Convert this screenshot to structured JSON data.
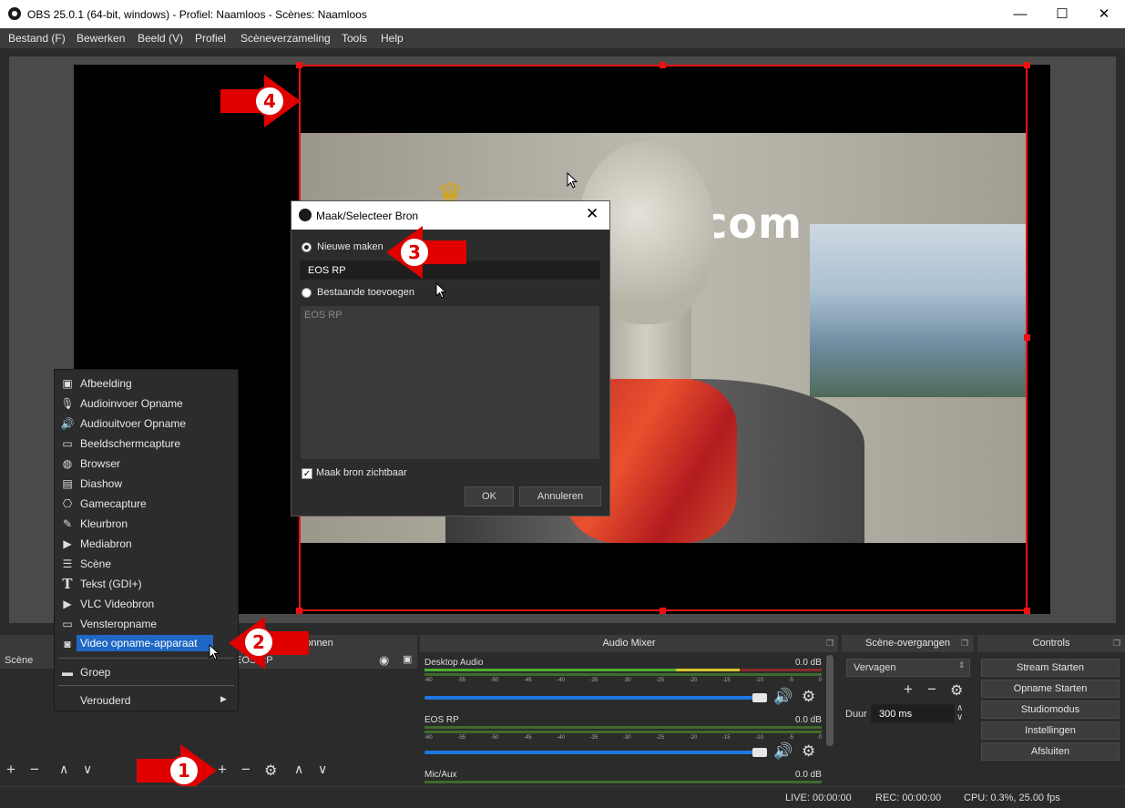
{
  "window": {
    "title": "OBS 25.0.1 (64-bit, windows) - Profiel: Naamloos - Scènes: Naamloos",
    "minimize": "—",
    "maximize": "☐",
    "close": "✕"
  },
  "menubar": [
    "Bestand (F)",
    "Bewerken",
    "Beeld (V)",
    "Profiel",
    "Scèneverzameling",
    "Tools",
    "Help"
  ],
  "preview": {
    "brand_text": "rkosoft.com",
    "crown": "♛"
  },
  "annotations": [
    "1",
    "2",
    "3",
    "4"
  ],
  "dialog": {
    "title": "Maak/Selecteer Bron",
    "new_label": "Nieuwe maken",
    "new_value": "EOS RP",
    "existing_label": "Bestaande toevoegen",
    "existing_items": [
      "EOS RP"
    ],
    "visible_label": "Maak bron zichtbaar",
    "ok": "OK",
    "cancel": "Annuleren"
  },
  "context_menu": [
    {
      "icon": "image-icon",
      "glyph": "▣",
      "label": "Afbeelding"
    },
    {
      "icon": "microphone-icon",
      "glyph": "🎙",
      "label": "Audioinvoer Opname"
    },
    {
      "icon": "speaker-icon",
      "glyph": "🔊",
      "label": "Audiouitvoer Opname"
    },
    {
      "icon": "monitor-icon",
      "glyph": "▭",
      "label": "Beeldschermcapture"
    },
    {
      "icon": "globe-icon",
      "glyph": "◍",
      "label": "Browser"
    },
    {
      "icon": "slideshow-icon",
      "glyph": "▤",
      "label": "Diashow"
    },
    {
      "icon": "gamepad-icon",
      "glyph": "⎔",
      "label": "Gamecapture"
    },
    {
      "icon": "brush-icon",
      "glyph": "✎",
      "label": "Kleurbron"
    },
    {
      "icon": "play-icon",
      "glyph": "▶",
      "label": "Mediabron"
    },
    {
      "icon": "list-icon",
      "glyph": "☰",
      "label": "Scène"
    },
    {
      "icon": "text-icon",
      "glyph": "T",
      "label": "Tekst (GDI+)"
    },
    {
      "icon": "play-icon",
      "glyph": "▶",
      "label": "VLC Videobron"
    },
    {
      "icon": "window-icon",
      "glyph": "▭",
      "label": "Vensteropname"
    },
    {
      "icon": "camera-icon",
      "glyph": "◙",
      "label": "Video opname-apparaat"
    },
    {
      "icon": "folder-icon",
      "glyph": "▬",
      "label": "Groep"
    },
    {
      "icon": "",
      "glyph": "",
      "label": "Verouderd"
    }
  ],
  "scenes_dock": {
    "title": "Scènes",
    "item": "Scène"
  },
  "sources_dock": {
    "title": "Bronnen",
    "item": "EOS RP"
  },
  "mixer": {
    "title": "Audio Mixer",
    "ticks": [
      "-60",
      "-55",
      "-50",
      "-45",
      "-40",
      "-35",
      "-30",
      "-25",
      "-20",
      "-15",
      "-10",
      "-5",
      "0"
    ],
    "channels": [
      {
        "name": "Desktop Audio",
        "level": "0.0 dB"
      },
      {
        "name": "EOS RP",
        "level": "0.0 dB"
      },
      {
        "name": "Mic/Aux",
        "level": "0.0 dB"
      }
    ]
  },
  "transitions": {
    "title": "Scène-overgangen",
    "selected": "Vervagen",
    "duration_label": "Duur",
    "duration_value": "300 ms"
  },
  "controls": {
    "title": "Controls",
    "buttons": [
      "Stream Starten",
      "Opname Starten",
      "Studiomodus",
      "Instellingen",
      "Afsluiten"
    ]
  },
  "status": {
    "live": "LIVE: 00:00:00",
    "rec": "REC: 00:00:00",
    "cpu": "CPU: 0.3%, 25.00 fps"
  },
  "colors": {
    "accent": "#1e67c4",
    "selection": "#ee1111",
    "annotation": "#e00000"
  }
}
